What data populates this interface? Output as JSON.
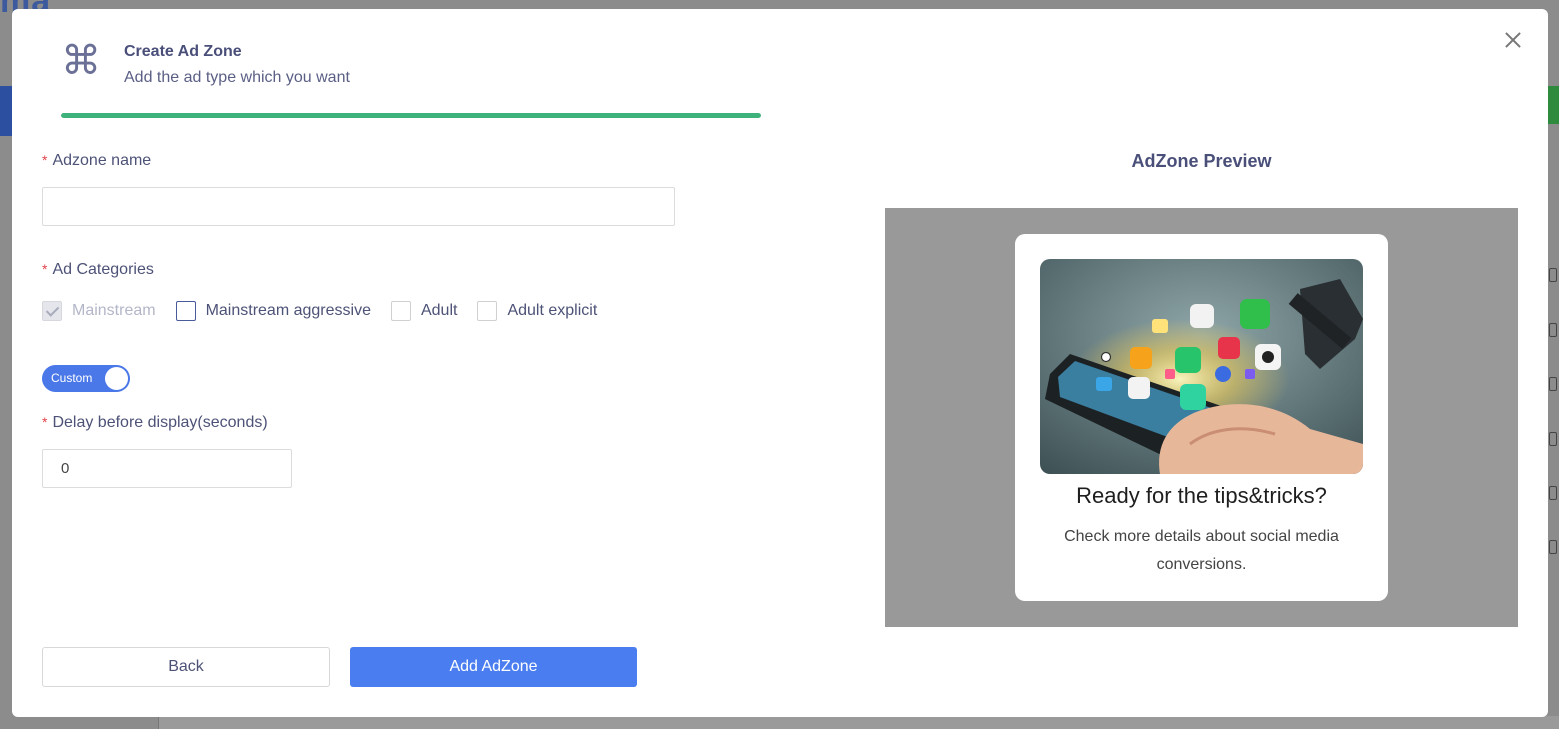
{
  "background": {
    "logo_text": "ma"
  },
  "modal": {
    "header": {
      "title": "Create Ad Zone",
      "subtitle": "Add the ad type which you want",
      "icon": "command-icon",
      "progress_percent": 100,
      "progress_color": "#3db27a"
    },
    "form": {
      "adzone_name": {
        "label": "Adzone name",
        "required_mark": "*",
        "value": ""
      },
      "ad_categories": {
        "label": "Ad Categories",
        "required_mark": "*",
        "options": [
          {
            "label": "Mainstream",
            "checked": true,
            "disabled": true
          },
          {
            "label": "Mainstream aggressive",
            "checked": false
          },
          {
            "label": "Adult",
            "checked": false
          },
          {
            "label": "Adult explicit",
            "checked": false
          }
        ]
      },
      "custom_toggle": {
        "label": "Custom",
        "on": true
      },
      "delay": {
        "label": "Delay before display(seconds)",
        "required_mark": "*",
        "value": "0"
      }
    },
    "buttons": {
      "back": "Back",
      "add": "Add AdZone"
    },
    "preview": {
      "title": "AdZone Preview",
      "card": {
        "title": "Ready for the tips&tricks?",
        "text": "Check more details about social media conversions."
      }
    },
    "colors": {
      "primary": "#4a7ef0",
      "required": "#e0444b",
      "accent_text": "#4a4f7a"
    }
  }
}
